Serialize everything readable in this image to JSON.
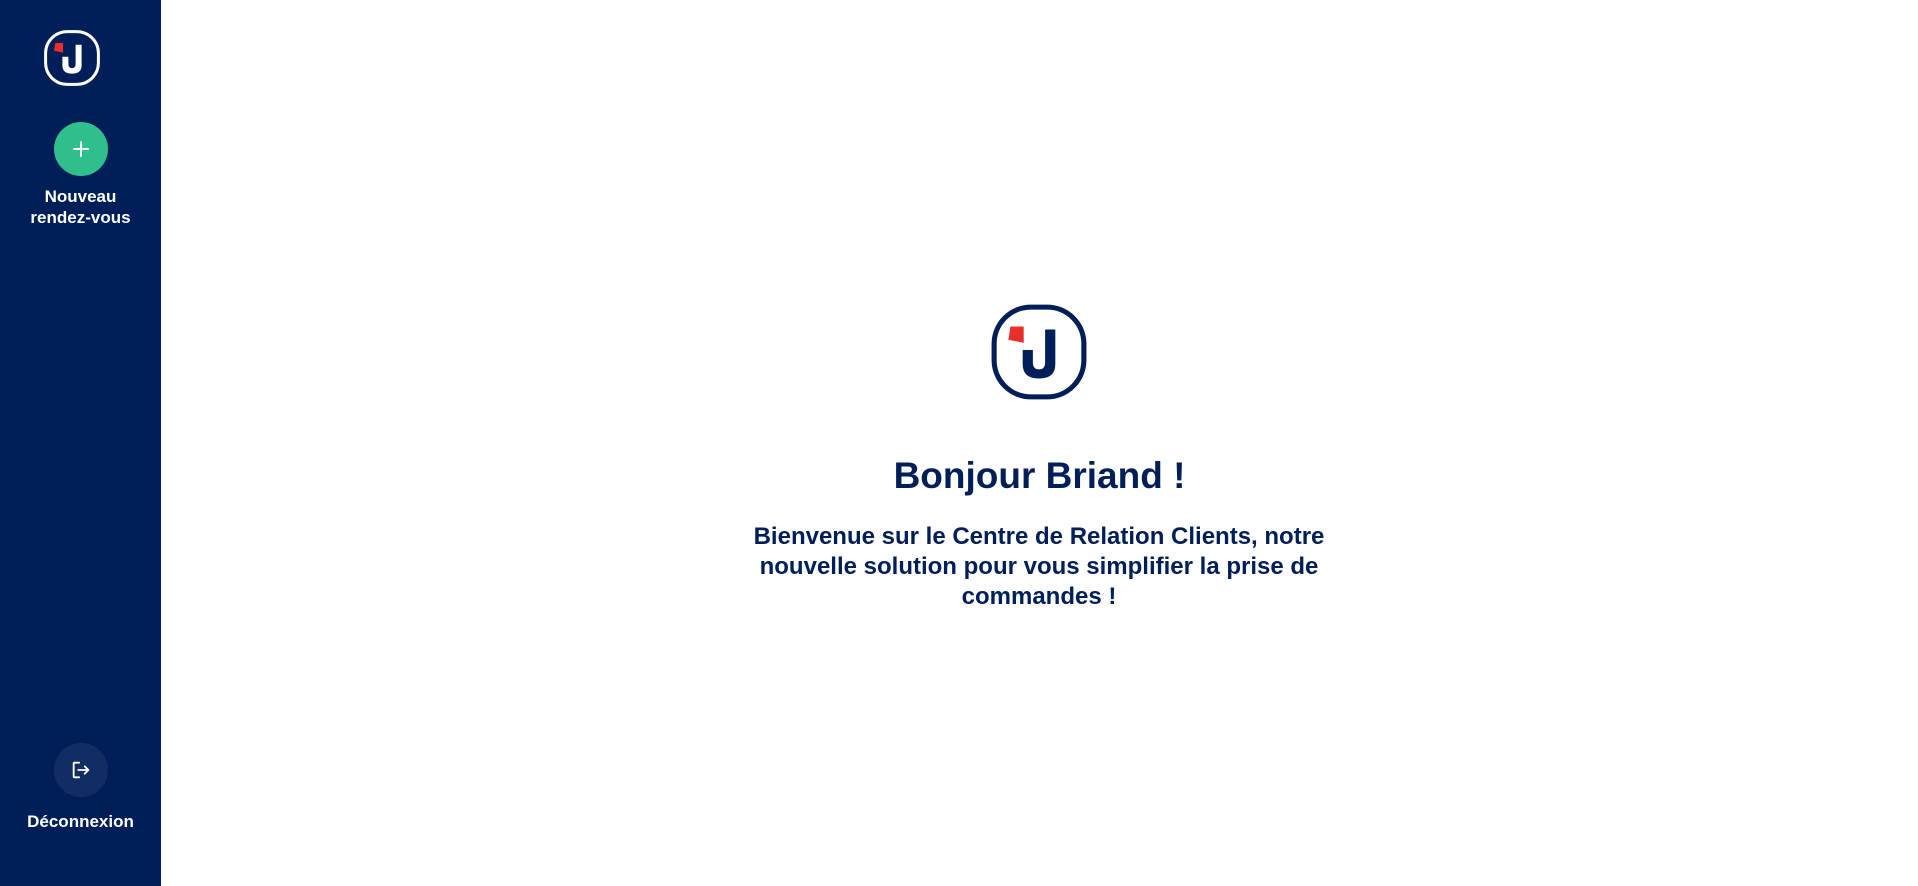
{
  "brand": {
    "primary": "#001e58",
    "accent_red": "#e8302a",
    "action_green": "#2fbf8d"
  },
  "sidebar": {
    "logo_icon": "brand-logo-icon",
    "new_appointment": {
      "icon": "plus-icon",
      "label": "Nouveau rendez-vous"
    },
    "logout": {
      "icon": "logout-icon",
      "label": "Déconnexion"
    }
  },
  "main": {
    "logo_icon": "brand-logo-icon",
    "greeting": "Bonjour Briand !",
    "welcome_message": "Bienvenue sur le Centre de Relation Clients, notre nouvelle solution pour vous simplifier la prise de commandes !"
  }
}
